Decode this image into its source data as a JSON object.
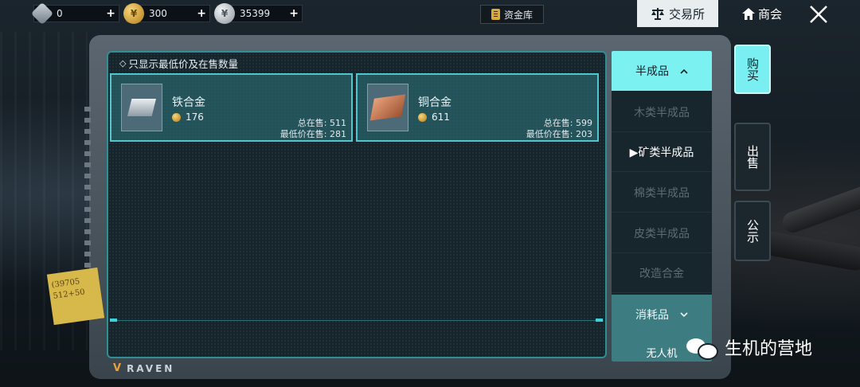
{
  "currencies": [
    {
      "icon": "diamond-icon",
      "value": "0"
    },
    {
      "icon": "gold-coin-icon",
      "value": "300"
    },
    {
      "icon": "silver-coin-icon",
      "value": "35399"
    }
  ],
  "plus_label": "+",
  "vault_label": "资金库",
  "nav": {
    "exchange_label": "交易所",
    "guild_label": "商会",
    "close_label": "✕"
  },
  "filter_label": "只显示最低价及在售数量",
  "items": [
    {
      "name": "铁合金",
      "price": "176",
      "total_label": "总在售:",
      "total": "511",
      "low_label": "最低价在售:",
      "low": "281"
    },
    {
      "name": "铜合金",
      "price": "611",
      "total_label": "总在售:",
      "total": "599",
      "low_label": "最低价在售:",
      "low": "203"
    }
  ],
  "categories": {
    "group1": "半成品",
    "items": [
      "木类半成品",
      "▶矿类半成品",
      "棉类半成品",
      "皮类半成品",
      "改造合金"
    ],
    "group2": "消耗品",
    "peek": "无人机"
  },
  "side_tabs": {
    "buy": "购买",
    "sell": "出售",
    "notice": "公示"
  },
  "brand": "RAVEN",
  "note_text": "(39705 512+50",
  "watermark": "生机的营地",
  "colors": {
    "accent": "#79eff1",
    "item_border": "#52c6cd",
    "exchange_tab": "#e8edf0"
  }
}
